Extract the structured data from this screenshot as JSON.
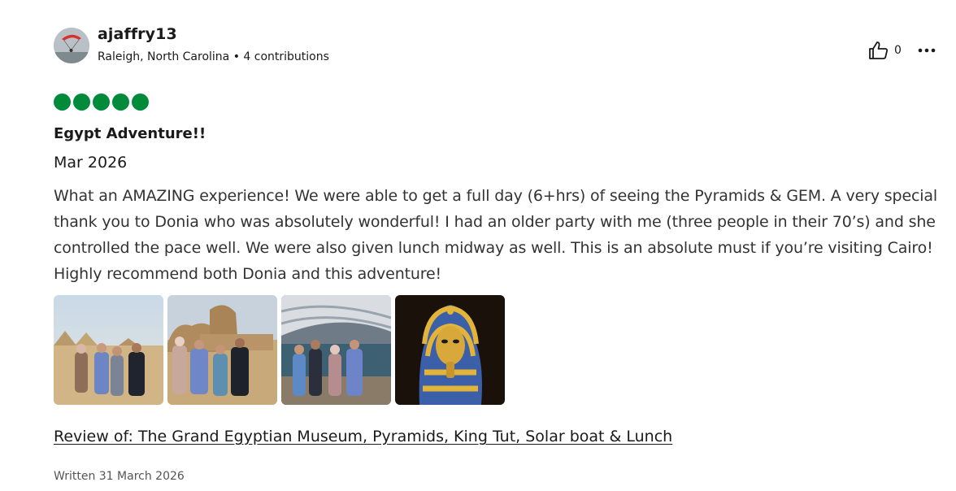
{
  "review": {
    "author": {
      "username": "ajaffry13",
      "location_contributions": "Raleigh, North Carolina • 4 contributions",
      "avatar_icon": "avatar-paraglider"
    },
    "helpful_count": "0",
    "rating": {
      "value": 5,
      "max": 5,
      "color": "#008a3a"
    },
    "title": "Egypt Adventure!!",
    "visit_date": "Mar 2026",
    "body": "What an AMAZING experience! We were able to get a full day (6+hrs) of seeing the Pyramids & GEM. A very special thank you to Donia who was absolutely wonderful! I had an older party with me (three people in their 70’s) and she controlled the pace well. We were also given lunch midway as well. This is an absolute must if you’re visiting Cairo! Highly recommend both Donia and this adventure!",
    "photos": [
      {
        "subject": "group-at-pyramids"
      },
      {
        "subject": "group-at-sphinx"
      },
      {
        "subject": "group-in-museum"
      },
      {
        "subject": "king-tut-mask"
      }
    ],
    "review_of": "Review of: The Grand Egyptian Museum, Pyramids, King Tut, Solar boat & Lunch",
    "written": "Written 31 March 2026"
  }
}
